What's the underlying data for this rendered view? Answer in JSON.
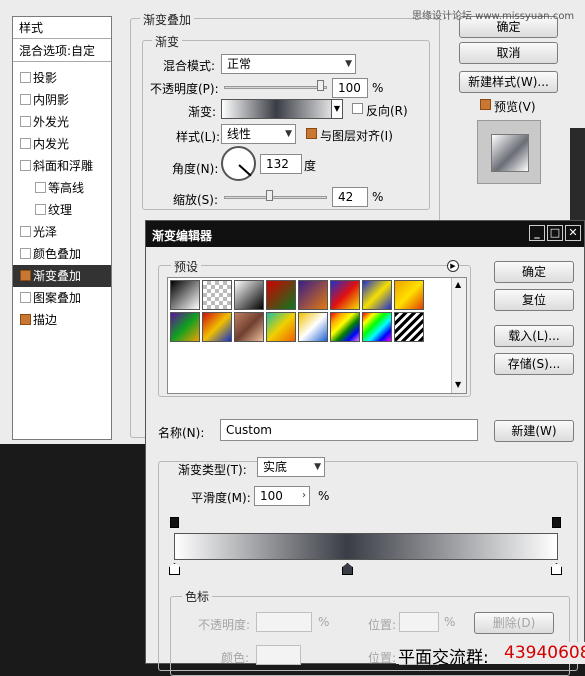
{
  "layer_style": {
    "list_title": "样式",
    "blend_options": "混合选项:自定",
    "items": [
      {
        "label": "投影",
        "checked": false,
        "sub": false
      },
      {
        "label": "内阴影",
        "checked": false,
        "sub": false
      },
      {
        "label": "外发光",
        "checked": false,
        "sub": false
      },
      {
        "label": "内发光",
        "checked": false,
        "sub": false
      },
      {
        "label": "斜面和浮雕",
        "checked": false,
        "sub": false
      },
      {
        "label": "等高线",
        "checked": false,
        "sub": true
      },
      {
        "label": "纹理",
        "checked": false,
        "sub": true
      },
      {
        "label": "光泽",
        "checked": false,
        "sub": false
      },
      {
        "label": "颜色叠加",
        "checked": false,
        "sub": false
      },
      {
        "label": "渐变叠加",
        "checked": true,
        "sub": false,
        "selected": true
      },
      {
        "label": "图案叠加",
        "checked": false,
        "sub": false
      },
      {
        "label": "描边",
        "checked": true,
        "sub": false
      }
    ],
    "section_title": "渐变叠加",
    "group_title": "渐变",
    "blend_mode_label": "混合模式:",
    "blend_mode_value": "正常",
    "opacity_label": "不透明度(P):",
    "opacity_value": "100",
    "percent": "%",
    "gradient_label": "渐变:",
    "reverse_label": "反向(R)",
    "style_label": "样式(L):",
    "style_value": "线性",
    "align_label": "与图层对齐(I)",
    "angle_label": "角度(N):",
    "angle_value": "132",
    "degree": "度",
    "scale_label": "缩放(S):",
    "scale_value": "42",
    "buttons": {
      "ok": "确定",
      "cancel": "取消",
      "new_style": "新建样式(W)...",
      "preview": "预览(V)"
    },
    "watermark": "思缘设计论坛 www.missyuan.com"
  },
  "gradient_editor": {
    "title": "渐变编辑器",
    "presets_label": "预设",
    "buttons": {
      "ok": "确定",
      "reset": "复位",
      "load": "载入(L)...",
      "save": "存储(S)...",
      "new": "新建(W)"
    },
    "name_label": "名称(N):",
    "name_value": "Custom",
    "type_label": "渐变类型(T):",
    "type_value": "实底",
    "smooth_label": "平滑度(M):",
    "smooth_value": "100",
    "percent": "%",
    "stops_group": "色标",
    "stop_opacity_label": "不透明度:",
    "stop_location_label": "位置:",
    "stop_color_label": "颜色:",
    "delete_label": "删除(D)",
    "percent_sign": "%"
  },
  "footer": {
    "text": "平面交流群:",
    "number": "43940608"
  }
}
